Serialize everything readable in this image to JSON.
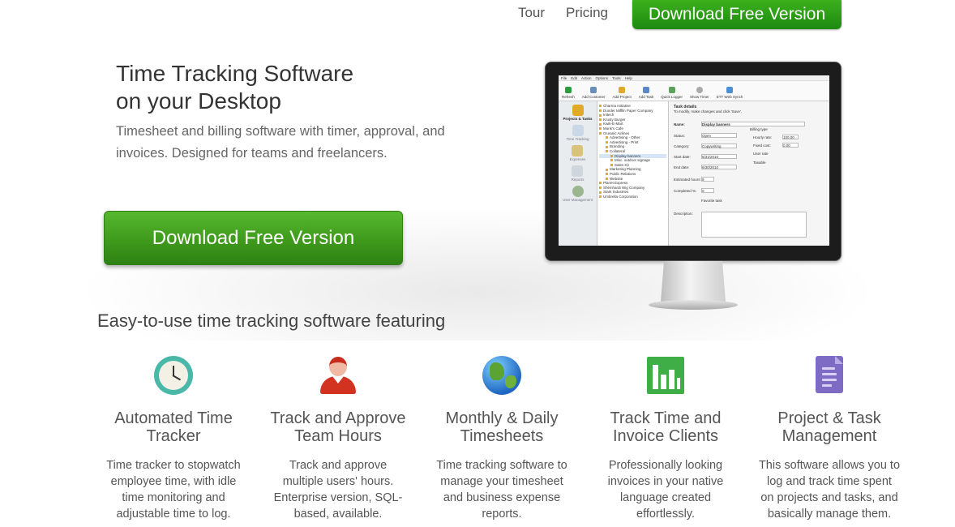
{
  "nav": {
    "tour": "Tour",
    "pricing": "Pricing",
    "cta": "Download Free Version"
  },
  "hero": {
    "title": "Time Tracking Software\non your Desktop",
    "subtitle": "Timesheet and billing software with timer, approval, and invoices. Designed for teams and freelancers.",
    "cta": "Download Free Version"
  },
  "app_screenshot": {
    "menu": [
      "File",
      "Edit",
      "Action",
      "Options",
      "Tools",
      "Help"
    ],
    "toolbar": [
      "Refresh",
      "Add Customer",
      "Add Project",
      "Add Task",
      "Quick Logger",
      "Show Timer",
      "ETT Web Synch"
    ],
    "nav": [
      "Projects & Tasks",
      "Time Tracking",
      "Expenses",
      "Reports",
      "User Management"
    ],
    "tree": [
      "Charma Initiative",
      "Dunder Mifflin Paper Company",
      "Initech",
      "Krusty Burger",
      "Kwik-E-Mart",
      "Monk's Cafe",
      "Oceanic Airlines",
      "Advertising - Other",
      "Advertising - Print",
      "Branding",
      "Collateral",
      "Display banners",
      "Misc. outdoor signage",
      "Sales Kit",
      "Marketing Planning",
      "Public Relations",
      "Website",
      "Planet Express",
      "Sheinhardt Wig Company",
      "Stark Industries",
      "Umbrella Corporation"
    ],
    "form_title": "Task details",
    "form_hint": "To modify, make changes and click 'Save'.",
    "name_label": "Name:",
    "name_value": "Display banners",
    "status_label": "Status:",
    "status_value": "Open",
    "category_label": "Category:",
    "category_value": "Copywriting",
    "start_label": "Start date:",
    "start_value": "5/31/2010",
    "end_label": "End date:",
    "end_value": "6/30/2010",
    "hours_label": "Estimated hours:",
    "hours_value": "9",
    "completed_label": "Completed %:",
    "completed_value": "0",
    "favorite_label": "Favorite task",
    "description_label": "Description:",
    "billing_type": "Billing type",
    "hourly_rate_label": "Hourly rate:",
    "hourly_rate_value": "100.00",
    "fixed_cost_label": "Fixed cost:",
    "fixed_cost_value": "0.00",
    "user_rate_label": "User rate",
    "taxable_label": "Taxable"
  },
  "features": {
    "heading": "Easy-to-use time tracking software featuring",
    "items": [
      {
        "title": "Automated Time\nTracker",
        "text": "Time tracker to stopwatch\nemployee time, with idle\ntime monitoring and\nadjustable time to log."
      },
      {
        "title": "Track and Approve\nTeam Hours",
        "text": "Track and approve\nmultiple users' hours.\nEnterprise version, SQL-\nbased, available."
      },
      {
        "title": "Monthly & Daily\nTimesheets",
        "text": "Time tracking software to\nmanage your timesheet\nand business expense\nreports."
      },
      {
        "title": "Track Time and\nInvoice Clients",
        "text": "Professionally looking\ninvoices in your native\nlanguage created\neffortlessly."
      },
      {
        "title": "Project & Task\nManagement",
        "text": "This software allows you to\nlog and track time spent\non projects and tasks, and\nbasically manage them."
      }
    ],
    "icons": [
      "clock-icon",
      "user-icon",
      "globe-icon",
      "bar-chart-icon",
      "document-icon"
    ]
  },
  "colors": {
    "cta_green": "#3f9a1c",
    "nav_cta_green": "#2a9c16"
  }
}
